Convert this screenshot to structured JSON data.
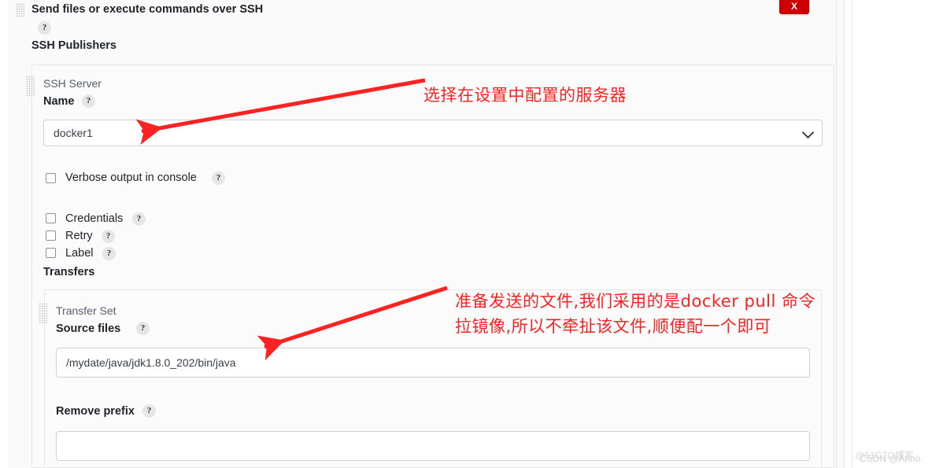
{
  "window": {
    "close_label": "X"
  },
  "header": {
    "title": "Send files or execute commands over SSH",
    "help": "?",
    "section_title": "SSH Publishers"
  },
  "ssh_server": {
    "panel_title": "SSH Server",
    "name_label": "Name",
    "name_help": "?",
    "name_value": "docker1",
    "chevron": "chevron-down-icon"
  },
  "options": [
    {
      "label": "Verbose output in console",
      "help": "?",
      "checked": false
    },
    {
      "label": "Credentials",
      "help": "?",
      "checked": false
    },
    {
      "label": "Retry",
      "help": "?",
      "checked": false
    },
    {
      "label": "Label",
      "help": "?",
      "checked": false
    }
  ],
  "transfers": {
    "title": "Transfers",
    "panel_title": "Transfer Set",
    "source_files_label": "Source files",
    "source_files_help": "?",
    "source_files_value": "/mydate/java/jdk1.8.0_202/bin/java",
    "remove_prefix_label": "Remove prefix",
    "remove_prefix_help": "?",
    "remove_prefix_value": ""
  },
  "annotations": [
    {
      "text": "选择在设置中配置的服务器"
    },
    {
      "text": "准备发送的文件,我们采用的是docker pull 命令"
    },
    {
      "text": "拉镜像,所以不牵扯该文件,顺便配一个即可"
    }
  ],
  "watermarks": {
    "primary": "@51CTO博客",
    "secondary": "CSDN @Arino"
  },
  "colors": {
    "accent_red": "#fb2222",
    "close_red": "#cc0000",
    "panel_bg": "#fbfbfb",
    "page_bg": "#fafafa",
    "border": "#e6e6e6",
    "field_border": "#ccd2d9"
  }
}
